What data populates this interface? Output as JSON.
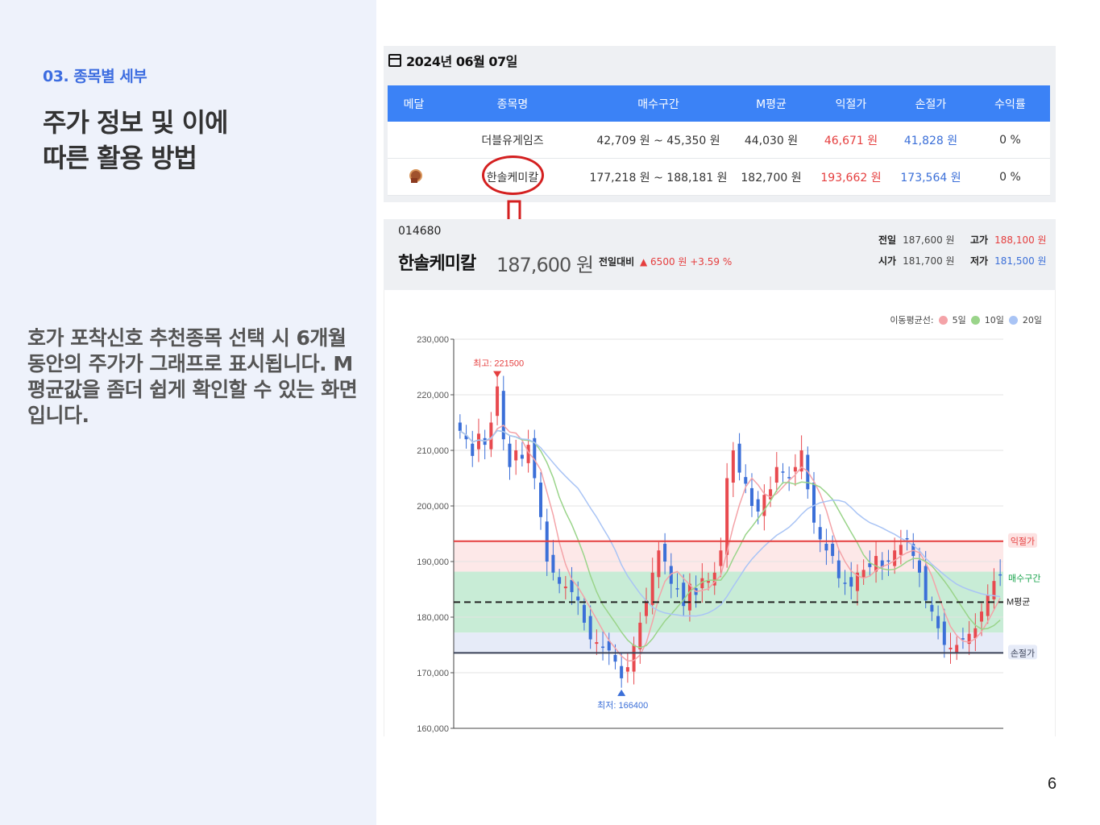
{
  "slide": {
    "section": "03. 종목별 세부",
    "heading_line1": "주가 정보 및 이에",
    "heading_line2": "따른 활용 방법",
    "description": "호가 포착신호 추천종목 선택 시 6개월 동안의 주가가 그래프로 표시됩니다. M평균값을 좀더 쉽게 확인할 수 있는 화면입니다.",
    "page_number": "6"
  },
  "table": {
    "date": "2024년 06월 07일",
    "headers": [
      "메달",
      "종목명",
      "매수구간",
      "M평균",
      "익절가",
      "손절가",
      "수익률"
    ],
    "rows": [
      {
        "medal": "",
        "name": "더블유게임즈",
        "buy_range": "42,709 원 ~ 45,350 원",
        "m_avg": "44,030 원",
        "take_profit": "46,671 원",
        "stop_loss": "41,828 원",
        "return": "0 %"
      },
      {
        "medal": "bronze-medal",
        "name": "한솔케미칼",
        "buy_range": "177,218 원 ~ 188,181 원",
        "m_avg": "182,700 원",
        "take_profit": "193,662 원",
        "stop_loss": "173,564 원",
        "return": "0 %"
      }
    ]
  },
  "stock": {
    "code": "014680",
    "name": "한솔케미칼",
    "price": "187,600 원",
    "change_label": "전일대비",
    "change": "▲ 6500 원  +3.59 %",
    "prev_label": "전일",
    "prev": "187,600 원",
    "high_label": "고가",
    "high": "188,100 원",
    "open_label": "시가",
    "open": "181,700 원",
    "low_label": "저가",
    "low": "181,500 원"
  },
  "chart_data": {
    "type": "candlestick",
    "legend_title": "이동평균선:",
    "ma_labels": [
      "5일",
      "10일",
      "20일"
    ],
    "ma_colors": [
      "#f4a3a8",
      "#9ad48a",
      "#a9c4f5"
    ],
    "ylim": [
      160000,
      230000
    ],
    "yticks": [
      "160,000",
      "170,000",
      "180,000",
      "190,000",
      "200,000",
      "210,000",
      "220,000",
      "230,000"
    ],
    "max_label": "최고: 221500",
    "min_label": "최저: 166400",
    "max_value": 221500,
    "min_value": 166400,
    "take_profit": 193662,
    "stop_loss": 173564,
    "m_avg": 182700,
    "buy_range": [
      177218,
      188181
    ],
    "take_profit_label": "익절가",
    "buy_label": "매수구간",
    "m_avg_label": "M평균",
    "stop_label": "손절가",
    "closes": [
      213500,
      212000,
      209000,
      213000,
      211000,
      215000,
      221500,
      212000,
      207000,
      210000,
      208500,
      211000,
      205000,
      198000,
      190000,
      188000,
      186000,
      185500,
      184500,
      183000,
      179000,
      176000,
      175500,
      174500,
      174000,
      172000,
      169000,
      171000,
      175000,
      179000,
      183000,
      188000,
      192000,
      190000,
      186000,
      185000,
      182000,
      186000,
      184000,
      187000,
      186500,
      188000,
      192000,
      205000,
      210000,
      206000,
      204000,
      200000,
      199000,
      202000,
      203000,
      207000,
      206000,
      205000,
      207000,
      210000,
      203000,
      197000,
      194000,
      192000,
      191000,
      187000,
      186000,
      185500,
      188000,
      188500,
      189000,
      191000,
      189000,
      190000,
      192000,
      193000,
      194000,
      191000,
      188000,
      183000,
      181000,
      178000,
      175000,
      174500,
      175000,
      176000,
      177000,
      178000,
      181000,
      184000,
      186500,
      187600
    ],
    "colors": [
      "#f2f2f2"
    ]
  }
}
